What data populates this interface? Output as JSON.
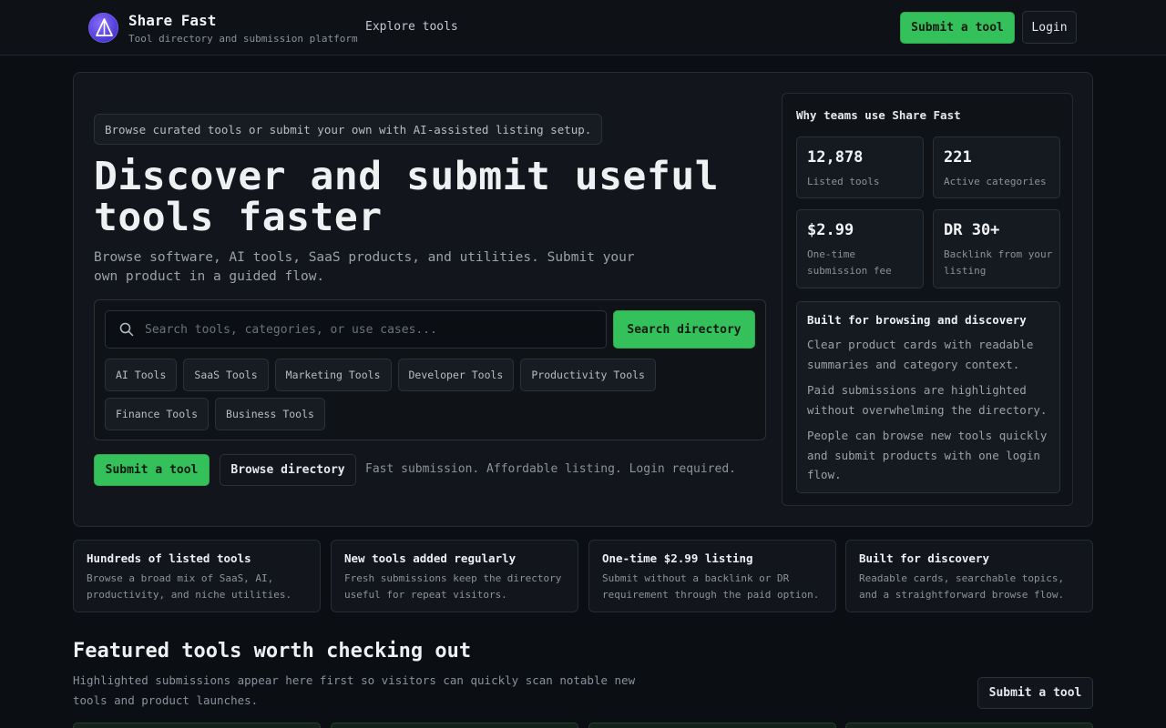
{
  "header": {
    "brand_name": "Share Fast",
    "brand_sub": "Tool directory and submission platform",
    "nav_explore": "Explore tools",
    "submit_label": "Submit a tool",
    "login_label": "Login"
  },
  "hero": {
    "pill": "Browse curated tools or submit your own with AI-assisted listing setup.",
    "title": "Discover and submit useful tools faster",
    "description": "Browse software, AI tools, SaaS products, and utilities. Submit your own product in a guided flow.",
    "search": {
      "placeholder": "Search tools, categories, or use cases...",
      "value": "",
      "button": "Search directory"
    },
    "chips": [
      "AI Tools",
      "SaaS Tools",
      "Marketing Tools",
      "Developer Tools",
      "Productivity Tools",
      "Finance Tools",
      "Business Tools"
    ],
    "cta_submit": "Submit a tool",
    "cta_browse": "Browse directory",
    "cta_note": "Fast submission. Affordable listing. Login required."
  },
  "why": {
    "title": "Why teams use Share Fast",
    "stats": [
      {
        "value": "12,878",
        "label": "Listed tools"
      },
      {
        "value": "221",
        "label": "Active categories"
      },
      {
        "value": "$2.99",
        "label": "One-time submission fee"
      },
      {
        "value": "DR 30+",
        "label": "Backlink from your listing"
      }
    ],
    "built": {
      "title": "Built for browsing and discovery",
      "points": [
        "Clear product cards with readable summaries and category context.",
        "Paid submissions are highlighted without overwhelming the directory.",
        "People can browse new tools quickly and submit products with one login flow."
      ]
    }
  },
  "features": [
    {
      "title": "Hundreds of listed tools",
      "desc": "Browse a broad mix of SaaS, AI, productivity, and niche utilities."
    },
    {
      "title": "New tools added regularly",
      "desc": "Fresh submissions keep the directory useful for repeat visitors."
    },
    {
      "title": "One-time $2.99 listing",
      "desc": "Submit without a backlink or DR requirement through the paid option."
    },
    {
      "title": "Built for discovery",
      "desc": "Readable cards, searchable topics, and a straightforward browse flow."
    }
  ],
  "featured": {
    "heading": "Featured tools worth checking out",
    "description": "Highlighted submissions appear here first so visitors can quickly scan notable new tools and product launches.",
    "submit_label": "Submit a tool"
  },
  "colors": {
    "accent_green": "#34c05a",
    "background": "#0b0e13",
    "panel": "#12161c",
    "logo_purple": "#6f5cf0"
  }
}
